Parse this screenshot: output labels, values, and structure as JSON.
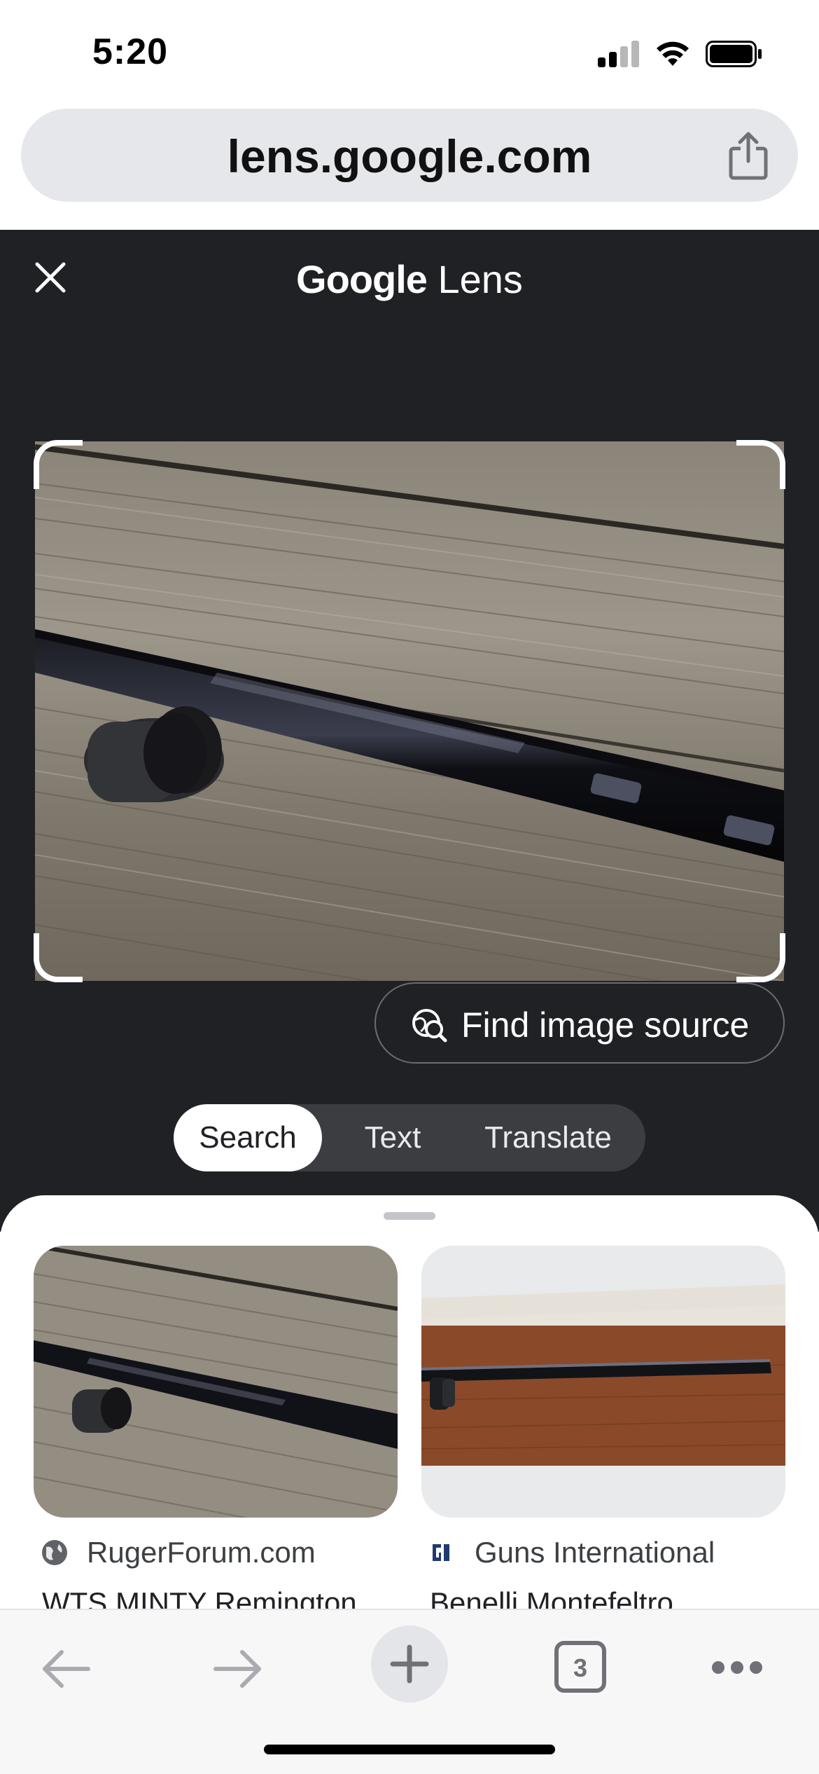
{
  "status_bar": {
    "time": "5:20"
  },
  "browser": {
    "url": "lens.google.com",
    "tab_count": "3"
  },
  "lens": {
    "title_brand": "Google",
    "title_word": "Lens",
    "find_source_label": "Find image source",
    "modes": [
      {
        "label": "Search",
        "active": true
      },
      {
        "label": "Text",
        "active": false
      },
      {
        "label": "Translate",
        "active": false
      }
    ]
  },
  "results": [
    {
      "source": "RugerForum.com",
      "source_icon": "globe-icon",
      "title": "WTS MINTY Remington"
    },
    {
      "source": "Guns International",
      "source_icon": "guns-international-logo",
      "title": "Benelli Montefeltro"
    }
  ],
  "colors": {
    "lens_background": "#202124",
    "url_bar": "#e6e7ea",
    "toolbar": "#f7f7f8",
    "tab_inactive_bg": "#3c3d41"
  }
}
